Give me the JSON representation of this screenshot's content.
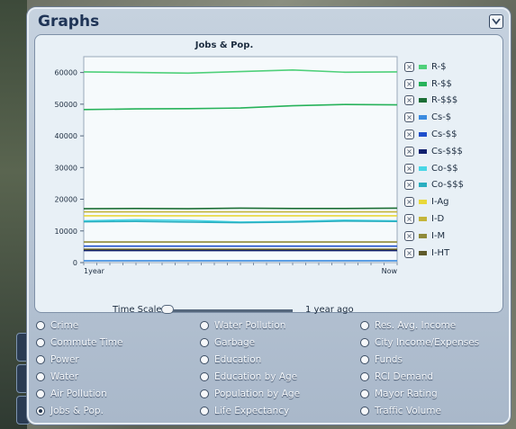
{
  "window": {
    "title": "Graphs"
  },
  "chart_data": {
    "type": "line",
    "title": "Jobs & Pop.",
    "ylim": [
      0,
      65000
    ],
    "yticks": [
      0,
      10000,
      20000,
      30000,
      40000,
      50000,
      60000
    ],
    "ytick_labels": [
      "0",
      "10000",
      "20000",
      "30000",
      "40000",
      "50000",
      "60000"
    ],
    "x_start_label": "1year",
    "x_end_label": "Now",
    "series": [
      {
        "name": "R-$",
        "color": "#4fd07a",
        "values": [
          60200,
          60000,
          59800,
          60300,
          60800,
          60100,
          60200
        ]
      },
      {
        "name": "R-$$",
        "color": "#27b25a",
        "values": [
          48300,
          48500,
          48600,
          48800,
          49500,
          49900,
          49800
        ]
      },
      {
        "name": "R-$$$",
        "color": "#1b6e35",
        "values": [
          17000,
          17100,
          17000,
          17200,
          17100,
          17100,
          17200
        ]
      },
      {
        "name": "Cs-$",
        "color": "#3a8be0",
        "values": [
          600,
          600,
          600,
          600,
          600,
          600,
          600
        ]
      },
      {
        "name": "Cs-$$",
        "color": "#1f4fcc",
        "values": [
          5200,
          5200,
          5200,
          5200,
          5200,
          5200,
          5200
        ]
      },
      {
        "name": "Cs-$$$",
        "color": "#10206e",
        "values": [
          3800,
          3800,
          3800,
          3800,
          3800,
          3800,
          3800
        ]
      },
      {
        "name": "Co-$$",
        "color": "#49d6e6",
        "values": [
          13200,
          13500,
          13300,
          12800,
          13000,
          13400,
          13200
        ]
      },
      {
        "name": "Co-$$$",
        "color": "#2aaec0",
        "values": [
          12900,
          13000,
          12800,
          12600,
          12800,
          13100,
          13000
        ]
      },
      {
        "name": "I-Ag",
        "color": "#e8d83a",
        "values": [
          14800,
          14800,
          14800,
          14800,
          14800,
          14800,
          14800
        ]
      },
      {
        "name": "I-D",
        "color": "#c4b53a",
        "values": [
          16000,
          16000,
          16000,
          16000,
          16000,
          16000,
          16000
        ]
      },
      {
        "name": "I-M",
        "color": "#8f8a3a",
        "values": [
          6500,
          6500,
          6500,
          6500,
          6500,
          6500,
          6500
        ]
      },
      {
        "name": "I-HT",
        "color": "#5e5a2a",
        "values": [
          4200,
          4200,
          4200,
          4200,
          4200,
          4200,
          4200
        ]
      }
    ]
  },
  "time_scale": {
    "label": "Time Scale",
    "value": "1 year ago"
  },
  "options": [
    {
      "label": "Crime",
      "selected": false
    },
    {
      "label": "Commute Time",
      "selected": false
    },
    {
      "label": "Power",
      "selected": false
    },
    {
      "label": "Water",
      "selected": false
    },
    {
      "label": "Air Pollution",
      "selected": false
    },
    {
      "label": "Jobs & Pop.",
      "selected": true
    },
    {
      "label": "Water Pollution",
      "selected": false
    },
    {
      "label": "Garbage",
      "selected": false
    },
    {
      "label": "Education",
      "selected": false
    },
    {
      "label": "Education by Age",
      "selected": false
    },
    {
      "label": "Population by Age",
      "selected": false
    },
    {
      "label": "Life Expectancy",
      "selected": false
    },
    {
      "label": "Res. Avg. Income",
      "selected": false
    },
    {
      "label": "City Income/Expenses",
      "selected": false
    },
    {
      "label": "Funds",
      "selected": false
    },
    {
      "label": "RCI Demand",
      "selected": false
    },
    {
      "label": "Mayor Rating",
      "selected": false
    },
    {
      "label": "Traffic Volume",
      "selected": false
    }
  ]
}
